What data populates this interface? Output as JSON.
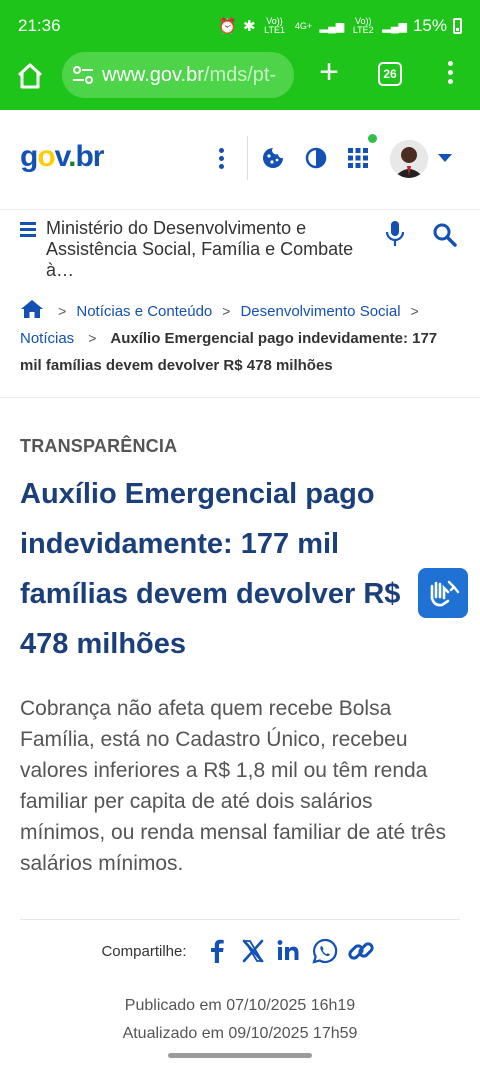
{
  "status_bar": {
    "time": "21:36",
    "network_1": "Vo)) LTE1",
    "network_2": "4G+",
    "network_3": "Vo)) LTE2",
    "battery": "15%"
  },
  "browser": {
    "url_host": "www.gov.br",
    "url_path": "/mds/pt-",
    "tab_count": "26"
  },
  "header": {
    "logo_g": "g",
    "logo_o": "o",
    "logo_v": "v",
    "logo_dot": ".",
    "logo_br": "br",
    "ministry": "Ministério do Desenvolvimento e Assistência Social, Família e Combate à…"
  },
  "breadcrumb": {
    "items": [
      "Notícias e Conteúdo",
      "Desenvolvimento Social",
      "Notícias"
    ],
    "current": "Auxílio Emergencial pago indevidamente: 177 mil famílias devem devolver R$ 478 milhões"
  },
  "article": {
    "kicker": "TRANSPARÊNCIA",
    "title": "Auxílio Emergencial pago indevidamente: 177 mil famílias devem devolver R$ 478 milhões",
    "summary": "Cobrança não afeta quem recebe Bolsa Família, está no Cadastro Único, recebeu valores inferiores a R$ 1,8 mil ou têm renda familiar per capita de até dois salários mínimos, ou renda mensal familiar de até três salários mínimos.",
    "share_label": "Compartilhe:",
    "published": "Publicado em 07/10/2025 16h19",
    "updated": "Atualizado em 09/10/2025 17h59"
  },
  "colors": {
    "browser_bar": "#1fc41b",
    "gov_blue": "#1351b4",
    "title_blue": "#1a3f7a",
    "vlibras_blue": "#1f71d4"
  },
  "icons": [
    "home-icon",
    "tune-icon",
    "plus-icon",
    "tabs-icon",
    "more-icon",
    "cookie-icon",
    "contrast-icon",
    "apps-grid-icon",
    "menu-icon",
    "mic-icon",
    "search-icon",
    "facebook-icon",
    "x-icon",
    "linkedin-icon",
    "whatsapp-icon",
    "link-icon",
    "vlibras-icon"
  ]
}
